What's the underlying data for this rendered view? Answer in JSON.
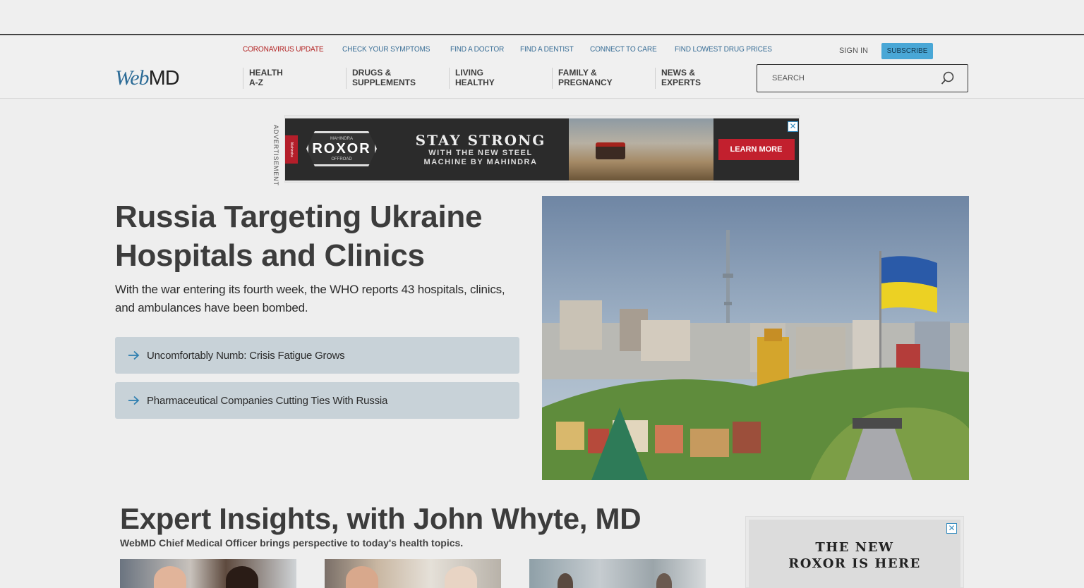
{
  "util_nav": [
    {
      "label": "CORONAVIRUS UPDATE",
      "highlight": true
    },
    {
      "label": "CHECK YOUR SYMPTOMS"
    },
    {
      "label": "FIND A DOCTOR"
    },
    {
      "label": "FIND A DENTIST"
    },
    {
      "label": "CONNECT TO CARE"
    },
    {
      "label": "FIND LOWEST DRUG PRICES"
    }
  ],
  "account": {
    "sign_in": "SIGN IN",
    "subscribe": "SUBSCRIBE"
  },
  "logo": {
    "web": "Web",
    "md": "MD"
  },
  "main_nav": [
    {
      "label": "HEALTH\nA-Z"
    },
    {
      "label": "DRUGS &\nSUPPLEMENTS"
    },
    {
      "label": "LIVING\nHEALTHY"
    },
    {
      "label": "FAMILY &\nPREGNANCY"
    },
    {
      "label": "NEWS &\nEXPERTS"
    }
  ],
  "search": {
    "placeholder": "SEARCH"
  },
  "top_ad": {
    "label": "ADVERTISEMENT",
    "tab": "Mahindra",
    "brand_small": "MAHINDRA",
    "brand": "ROXOR",
    "brand_foot": "OFFROAD",
    "headline": "STAY STRONG",
    "sub1": "WITH THE NEW STEEL",
    "sub2": "MACHINE BY MAHINDRA",
    "cta": "LEARN MORE",
    "close": "✕"
  },
  "hero": {
    "title": "Russia Targeting Ukraine Hospitals and Clinics",
    "description": "With the war entering its fourth week, the WHO reports 43 hospitals, clinics, and ambulances have been bombed.",
    "related": [
      {
        "label": "Uncomfortably Numb: Crisis Fatigue Grows"
      },
      {
        "label": "Pharmaceutical Companies Cutting Ties With Russia"
      }
    ]
  },
  "expert": {
    "title": "Expert Insights, with John Whyte, MD",
    "subtitle": "WebMD Chief Medical Officer brings perspective to today's health topics."
  },
  "side_ad": {
    "line1": "THE NEW",
    "line2": "ROXOR IS HERE",
    "close": "✕"
  },
  "colors": {
    "link": "#3a6f97",
    "alert": "#b32424",
    "subscribe": "#49a7d6",
    "related_bg": "#c8d2d8"
  }
}
